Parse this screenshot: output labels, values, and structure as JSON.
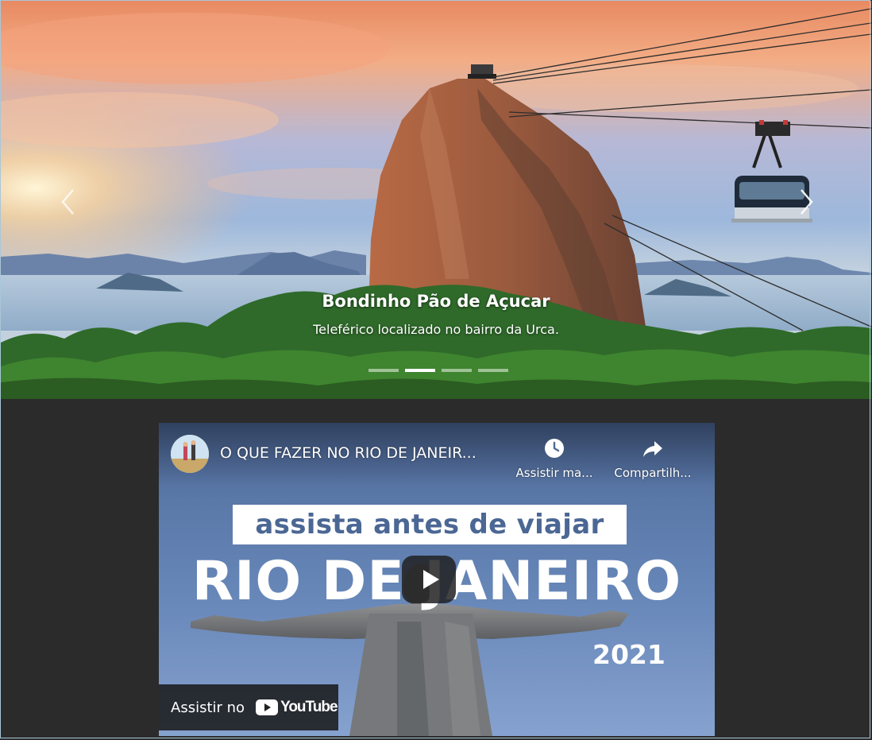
{
  "carousel": {
    "slide_title": "Bondinho Pão de Açucar",
    "slide_caption": "Teleférico localizado no bairro da Urca.",
    "slide_count": 4,
    "active_slide": 2,
    "prev_icon": "chevron-left-icon",
    "next_icon": "chevron-right-icon"
  },
  "video": {
    "title": "O QUE FAZER NO RIO DE JANEIR...",
    "watch_later_label": "Assistir ma...",
    "share_label": "Compartilh...",
    "banner_text": "assista antes de viajar",
    "headline": "RIO DE JANEIRO",
    "year": "2021",
    "watch_on_label": "Assistir no",
    "youtube_wordmark": "YouTube",
    "colors": {
      "banner_text": "#4b6794",
      "youtube_red": "#ff0000"
    }
  }
}
